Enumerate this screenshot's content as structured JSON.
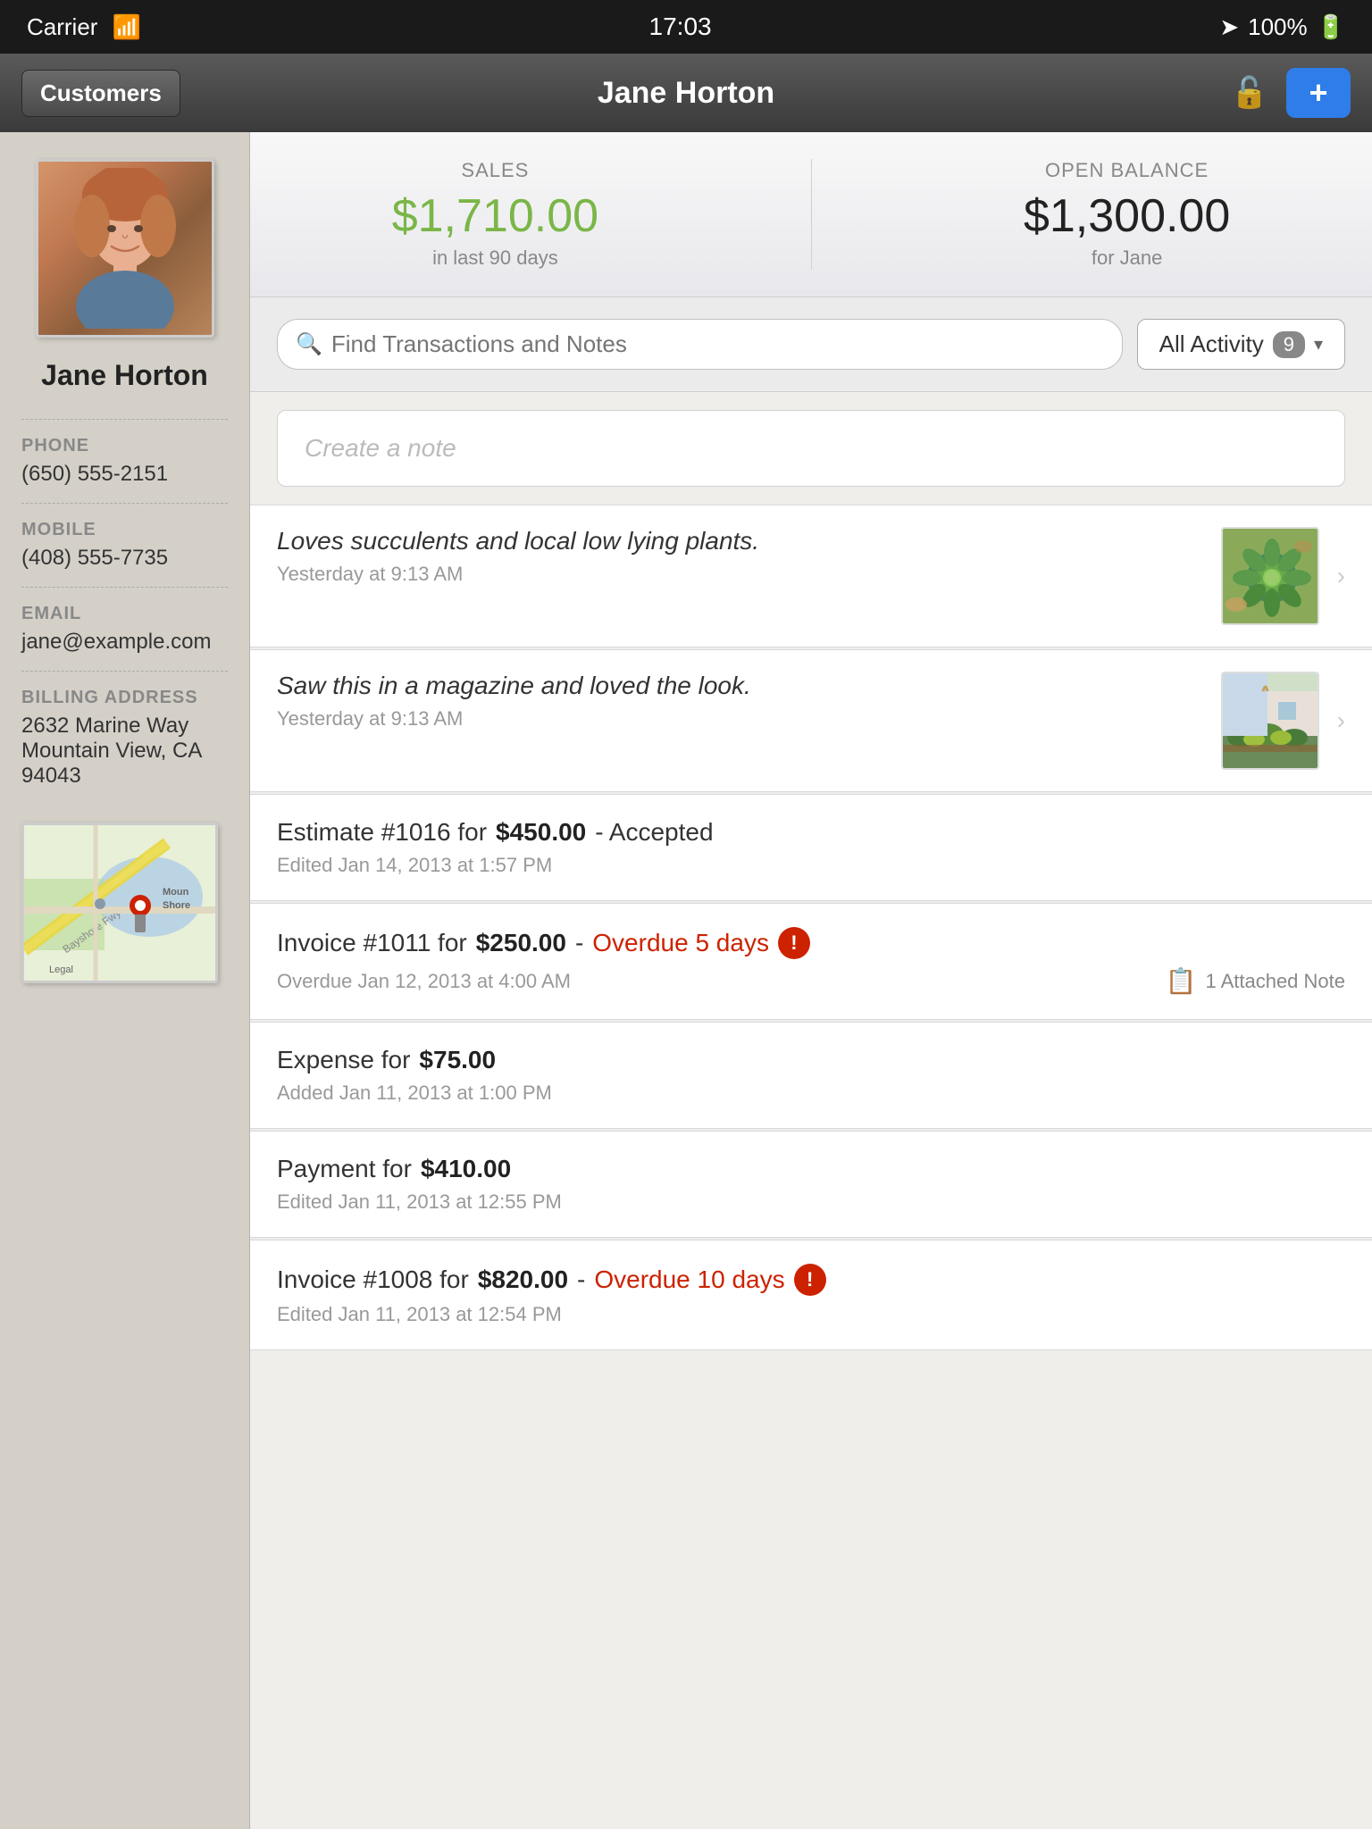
{
  "statusBar": {
    "carrier": "Carrier",
    "wifi": "wifi",
    "time": "17:03",
    "location": "▲",
    "battery": "100%"
  },
  "navBar": {
    "backLabel": "Customers",
    "title": "Jane Horton",
    "addLabel": "+"
  },
  "sidebar": {
    "customerName": "Jane Horton",
    "phone": {
      "label": "PHONE",
      "value": "(650) 555-2151"
    },
    "mobile": {
      "label": "MOBILE",
      "value": "(408) 555-7735"
    },
    "email": {
      "label": "EMAIL",
      "value": "jane@example.com"
    },
    "billingAddress": {
      "label": "BILLING ADDRESS",
      "line1": "2632 Marine Way",
      "line2": "Mountain View, CA 94043"
    }
  },
  "stats": {
    "sales": {
      "label": "SALES",
      "value": "$1,710.00",
      "sub": "in last 90 days"
    },
    "openBalance": {
      "label": "OPEN BALANCE",
      "value": "$1,300.00",
      "sub": "for Jane"
    }
  },
  "search": {
    "placeholder": "Find Transactions and Notes",
    "filterLabel": "All Activity",
    "filterCount": "9"
  },
  "createNote": {
    "placeholder": "Create a note"
  },
  "activity": [
    {
      "type": "note",
      "text": "Loves succulents and local low lying plants.",
      "time": "Yesterday at 9:13 AM",
      "hasThumb": true,
      "thumbType": "succulent"
    },
    {
      "type": "note",
      "text": "Saw this in a magazine and loved the look.",
      "time": "Yesterday at 9:13 AM",
      "hasThumb": true,
      "thumbType": "garden"
    },
    {
      "type": "transaction",
      "title": "Estimate #1016 for ",
      "amount": "$450.00",
      "status": " - Accepted",
      "overdueText": "",
      "isOverdue": false,
      "dateLabel": "Edited Jan 14, 2013 at 1:57 PM",
      "attachedNote": "",
      "attachedNoteCount": ""
    },
    {
      "type": "transaction",
      "title": "Invoice #1011 for ",
      "amount": "$250.00",
      "status": " - ",
      "overdueText": "Overdue 5 days",
      "isOverdue": true,
      "dateLabel": "Overdue Jan 12, 2013 at 4:00 AM",
      "attachedNote": "1 Attached Note",
      "attachedNoteCount": "1"
    },
    {
      "type": "transaction",
      "title": "Expense for ",
      "amount": "$75.00",
      "status": "",
      "overdueText": "",
      "isOverdue": false,
      "dateLabel": "Added Jan 11, 2013 at 1:00 PM",
      "attachedNote": "",
      "attachedNoteCount": ""
    },
    {
      "type": "transaction",
      "title": "Payment for ",
      "amount": "$410.00",
      "status": "",
      "overdueText": "",
      "isOverdue": false,
      "dateLabel": "Edited Jan 11, 2013 at 12:55 PM",
      "attachedNote": "",
      "attachedNoteCount": ""
    },
    {
      "type": "transaction",
      "title": "Invoice #1008 for ",
      "amount": "$820.00",
      "status": " - ",
      "overdueText": "Overdue 10 days",
      "isOverdue": true,
      "dateLabel": "Edited Jan 11, 2013 at 12:54 PM",
      "attachedNote": "",
      "attachedNoteCount": ""
    }
  ]
}
